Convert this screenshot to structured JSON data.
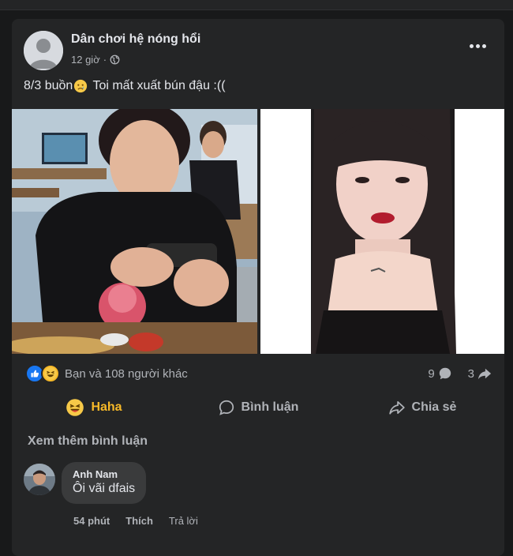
{
  "post": {
    "author": "Dân chơi hệ nóng hổi",
    "time": "12 giờ",
    "separator": "·",
    "privacy_icon": "globe-icon",
    "caption_before": "8/3 buồn",
    "caption_emoji": "sad-crying-face-emoji",
    "caption_after": " Toi mất xuất bún đậu :(("
  },
  "reactions": {
    "icons": [
      "like-icon",
      "haha-icon"
    ],
    "summary": "Bạn và 108 người khác",
    "comments_count": "9",
    "shares_count": "3"
  },
  "actions": {
    "reaction_label": "Haha",
    "comment_label": "Bình luận",
    "share_label": "Chia sẻ"
  },
  "comments": {
    "view_more": "Xem thêm bình luận",
    "items": [
      {
        "author": "Anh Nam",
        "text": "Ôi vãi dfais",
        "time": "54 phút",
        "like_label": "Thích",
        "reply_label": "Trả lời"
      }
    ]
  },
  "colors": {
    "background": "#18191a",
    "card": "#242526",
    "text_primary": "#e4e6eb",
    "text_secondary": "#b0b3b8",
    "haha_active": "#f7b928",
    "like_blue": "#1877f2"
  }
}
